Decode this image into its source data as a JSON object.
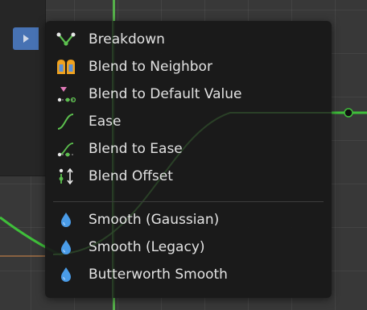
{
  "menu": {
    "items": [
      {
        "id": "breakdown",
        "label": "Breakdown",
        "icon": "breakdown-icon"
      },
      {
        "id": "blend-to-neighbor",
        "label": "Blend to Neighbor",
        "icon": "blend-neighbor-icon"
      },
      {
        "id": "blend-to-default-value",
        "label": "Blend to Default Value",
        "icon": "blend-default-icon"
      },
      {
        "id": "ease",
        "label": "Ease",
        "icon": "ease-curve-icon"
      },
      {
        "id": "blend-to-ease",
        "label": "Blend to Ease",
        "icon": "blend-ease-icon"
      },
      {
        "id": "blend-offset",
        "label": "Blend Offset",
        "icon": "blend-offset-icon"
      },
      {
        "id": "smooth-gaussian",
        "label": "Smooth (Gaussian)",
        "icon": "droplet-icon"
      },
      {
        "id": "smooth-legacy",
        "label": "Smooth (Legacy)",
        "icon": "droplet-icon"
      },
      {
        "id": "butterworth-smooth",
        "label": "Butterworth Smooth",
        "icon": "droplet-icon"
      }
    ]
  },
  "colors": {
    "menu_bg": "#181818",
    "text": "#e3e3e3",
    "accent_blue": "#4772b3",
    "curve_green": "#55b04a",
    "droplet_blue": "#4a9ce8",
    "icon_orange": "#f0a21e"
  }
}
